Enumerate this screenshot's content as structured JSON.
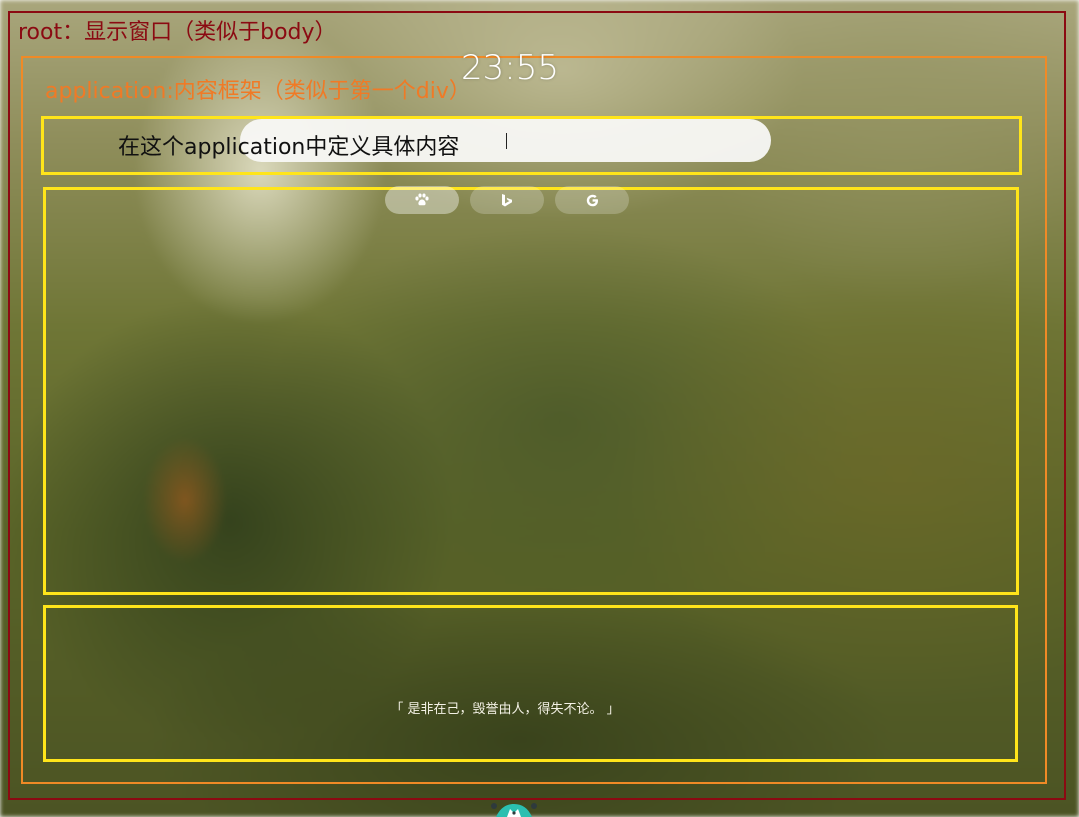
{
  "labels": {
    "root": "root：显示窗口（类似于body）",
    "application": "application:内容框架（类似于第一个div）",
    "content": "在这个application中定义具体内容"
  },
  "clock": {
    "time": "23:55"
  },
  "search": {
    "value": "",
    "engines": [
      {
        "name": "baidu",
        "icon": "paw-icon",
        "active": true
      },
      {
        "name": "bing",
        "icon": "bing-icon",
        "active": false
      },
      {
        "name": "google",
        "icon": "google-icon",
        "active": false
      }
    ]
  },
  "footer": {
    "quote": "「 是非在己，毁誉由人，得失不论。 」"
  },
  "colors": {
    "root_frame": "#8b0a12",
    "application_frame": "#f08a26",
    "content_boxes": "#ffe51a",
    "search_bar": "#f8f8f6"
  }
}
